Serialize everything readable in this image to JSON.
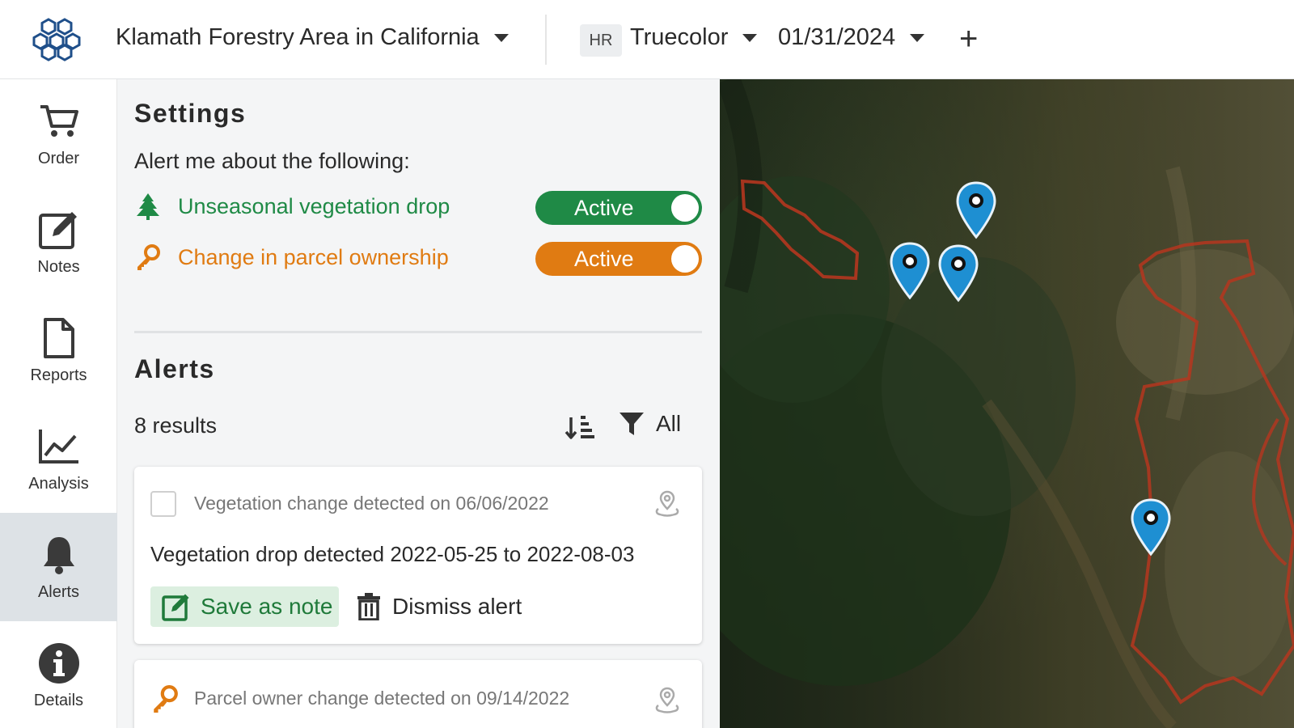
{
  "header": {
    "aoi_name": "Klamath Forestry Area in California",
    "resolution_badge": "HR",
    "layer_name": "Truecolor",
    "date": "01/31/2024"
  },
  "nav": {
    "items": [
      {
        "label": "Order",
        "icon": "cart-icon"
      },
      {
        "label": "Notes",
        "icon": "edit-note-icon"
      },
      {
        "label": "Reports",
        "icon": "document-icon"
      },
      {
        "label": "Analysis",
        "icon": "chart-line-icon"
      },
      {
        "label": "Alerts",
        "icon": "bell-icon",
        "active": true
      },
      {
        "label": "Details",
        "icon": "info-icon"
      }
    ]
  },
  "settings": {
    "title": "Settings",
    "subtitle": "Alert me about the following:",
    "rules": [
      {
        "label": "Unseasonal vegetation drop",
        "status": "Active",
        "color": "#1f8a46",
        "icon": "tree-icon"
      },
      {
        "label": "Change in parcel ownership",
        "status": "Active",
        "color": "#e07b12",
        "icon": "key-icon"
      }
    ]
  },
  "alerts": {
    "title": "Alerts",
    "results": "8 results",
    "filter_label": "All",
    "items": [
      {
        "title": "Vegetation change detected on 06/06/2022",
        "description": "Vegetation drop detected 2022-05-25 to 2022-08-03",
        "save_label": "Save as note",
        "dismiss_label": "Dismiss alert"
      },
      {
        "title": "Parcel owner change detected on 09/14/2022"
      }
    ]
  },
  "colors": {
    "vegetation_green": "#1f8a46",
    "ownership_orange": "#e07b12",
    "marker_blue": "#1e8fd2",
    "parcel_red": "#b5361f",
    "nav_active_bg": "#dde2e6"
  }
}
